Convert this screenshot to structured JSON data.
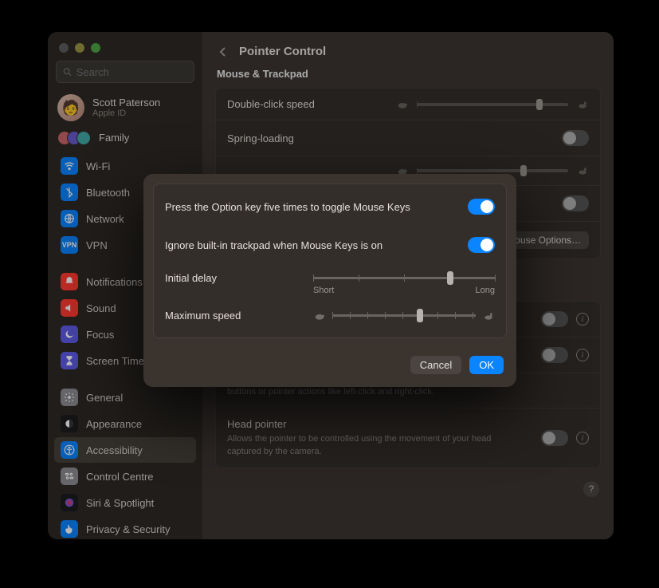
{
  "traffic": {
    "close": "close",
    "min": "minimize",
    "max": "maximize"
  },
  "search": {
    "placeholder": "Search"
  },
  "user": {
    "name": "Scott Paterson",
    "sub": "Apple ID"
  },
  "family": {
    "label": "Family"
  },
  "sidebar": {
    "groups": [
      [
        {
          "icon": "wifi",
          "color": "#0a84ff",
          "label": "Wi-Fi"
        },
        {
          "icon": "bluetooth",
          "color": "#0a84ff",
          "label": "Bluetooth"
        },
        {
          "icon": "network",
          "color": "#0a84ff",
          "label": "Network"
        },
        {
          "icon": "vpn",
          "color": "#0a84ff",
          "label": "VPN"
        }
      ],
      [
        {
          "icon": "bell",
          "color": "#ff3b30",
          "label": "Notifications"
        },
        {
          "icon": "sound",
          "color": "#ff3b30",
          "label": "Sound"
        },
        {
          "icon": "moon",
          "color": "#5e5ce6",
          "label": "Focus"
        },
        {
          "icon": "hourglass",
          "color": "#5e5ce6",
          "label": "Screen Time"
        }
      ],
      [
        {
          "icon": "gear",
          "color": "#8e8e93",
          "label": "General"
        },
        {
          "icon": "appearance",
          "color": "#1c1c1e",
          "label": "Appearance"
        },
        {
          "icon": "accessibility",
          "color": "#0a84ff",
          "label": "Accessibility",
          "selected": true
        },
        {
          "icon": "control",
          "color": "#8e8e93",
          "label": "Control Centre"
        },
        {
          "icon": "siri",
          "color": "#1c1c1e",
          "label": "Siri & Spotlight"
        },
        {
          "icon": "hand",
          "color": "#0a84ff",
          "label": "Privacy & Security"
        }
      ]
    ]
  },
  "header": {
    "title": "Pointer Control",
    "section": "Mouse & Trackpad"
  },
  "rows": {
    "doubleClick": {
      "label": "Double-click speed"
    },
    "springLoading": {
      "label": "Spring-loading"
    },
    "mouseOptions": {
      "button": "ouse Options…"
    }
  },
  "bottom": {
    "alt": {
      "desc": "buttons or pointer actions like left-click and right-click."
    },
    "head": {
      "title": "Head pointer",
      "desc": "Allows the pointer to be controlled using the movement of your head captured by the camera."
    }
  },
  "sheet": {
    "optionKey": {
      "label": "Press the Option key five times to toggle Mouse Keys",
      "on": true
    },
    "ignoreTrackpad": {
      "label": "Ignore built-in trackpad when Mouse Keys is on",
      "on": true
    },
    "initialDelay": {
      "label": "Initial delay",
      "min": "Short",
      "max": "Long"
    },
    "maxSpeed": {
      "label": "Maximum speed"
    },
    "cancel": "Cancel",
    "ok": "OK"
  },
  "help": "?"
}
